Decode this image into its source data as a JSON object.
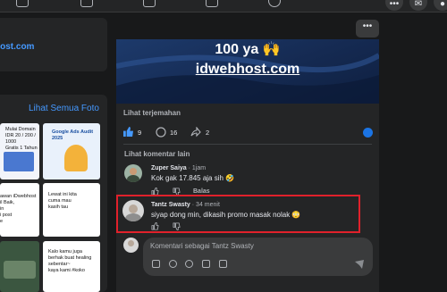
{
  "left": {
    "site_fragment": "host.com",
    "see_all_photos": "Lihat Semua Foto",
    "tiles": [
      {
        "lines": [
          "Mulai Domain",
          "IDR 20 / 200 / 1000",
          "Gratis 1 Tahun"
        ]
      },
      {
        "lines": [
          "Google Ads Audit 2025"
        ]
      },
      {
        "lines": [
          "awan iDwebhost",
          "il Baik,",
          "in",
          "i post",
          "e"
        ]
      },
      {
        "lines": [
          "Lewat ini kita",
          "cuma mau",
          "kasih tau"
        ]
      },
      {
        "lines": []
      },
      {
        "lines": [
          "Kalo kamu juga",
          "berhak buat healing",
          "sebentar~",
          "kaya kami #koko"
        ]
      }
    ]
  },
  "post": {
    "more_label": "•••",
    "hero_top_text": "100 ya 🙌",
    "hero_site": "idwebhost.com",
    "translate_label": "Lihat terjemahan",
    "likes_count": "9",
    "comments_count": "16",
    "shares_count": "2",
    "other_comments_label": "Lihat komentar lain",
    "comments": [
      {
        "name": "Zuper Saiya",
        "time": "· 1jam",
        "text": "Kok gak 17.845 aja sih 🤣",
        "reply_label": "Balas"
      },
      {
        "name": "Tantz Swasty",
        "time": "· 34 menit",
        "text": "siyap dong min, dikasih promo masak nolak 😳"
      }
    ],
    "comment_placeholder": "Komentari sebagai Tantz Swasty"
  },
  "colors": {
    "accent": "#4599ff",
    "highlight": "#e0212b",
    "like_blue": "#1b74e4"
  }
}
